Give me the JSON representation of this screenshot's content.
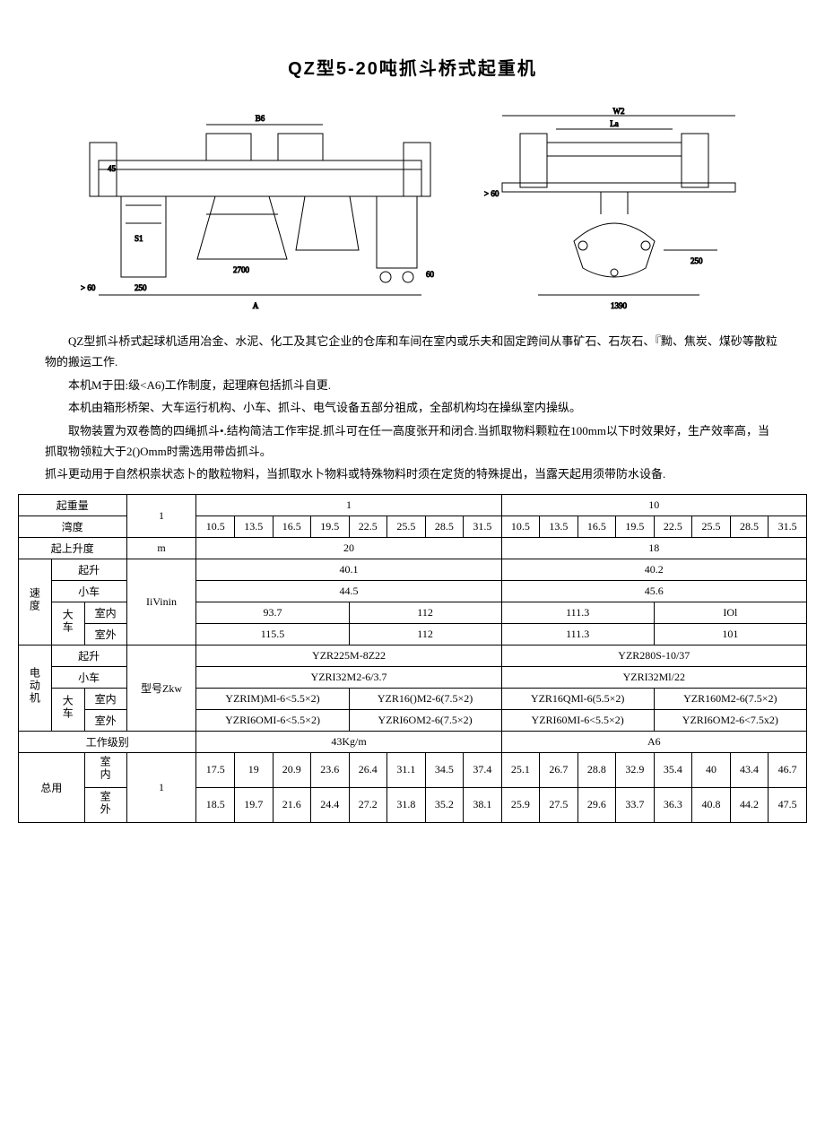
{
  "title": "QZ型5-20吨抓斗桥式起重机",
  "desc": {
    "p1": "QZ型抓斗桥式起球机适用冶金、水泥、化工及其它企业的仓库和车间在室内或乐夫和固定跨间从事矿石、石灰石、『黝、焦炭、煤砂等散粒物的搬运工作.",
    "p2": "本机M于田:级<A6)工作制度，起理麻包括抓斗自更.",
    "p3": "本机由箱形桥架、大车运行机构、小车、抓斗、电气设备五部分祖成，全部机构均在操纵室内操纵。",
    "p4": "取物装置为双卷筒的四绳抓斗•.结构简洁工作牢捉.抓斗可在任一高度张开和闭合.当抓取物料颗粒在100mm以下时效果好，生产效率高，当抓取物领粒大于2()Omm时需选用带齿抓斗。",
    "p5": "抓斗更动用于自然枳祟状态卜的散粒物料，当抓取水卜物料或特殊物料时须在定货的特殊提出，当露天起用须带防水设备."
  },
  "headers": {
    "lifting_weight": "起重量",
    "span": "湾度",
    "lift_height": "起上升度",
    "speed": "速度",
    "hoist": "起升",
    "trolley": "小车",
    "bridge": "大车",
    "indoor": "室内",
    "outdoor": "室外",
    "motor": "电动机",
    "model_power": "型号Zkw",
    "work_class": "工作级别",
    "total_weight": "总用",
    "unit_m": "m",
    "unit_speed": "IiVinin",
    "unit_t": "1"
  },
  "spec": {
    "weight_1": "1",
    "weight_10": "10",
    "spans_1": [
      "10.5",
      "13.5",
      "16.5",
      "19.5",
      "22.5",
      "25.5",
      "28.5",
      "31.5"
    ],
    "spans_10": [
      "10.5",
      "13.5",
      "16.5",
      "19.5",
      "22.5",
      "25.5",
      "28.5",
      "31.5"
    ],
    "lift_h_1": "20",
    "lift_h_10": "18",
    "hoist_spd_1": "40.1",
    "hoist_spd_10": "40.2",
    "trolley_spd_1": "44.5",
    "trolley_spd_10": "45.6",
    "bridge_in_1a": "93.7",
    "bridge_in_1b": "112",
    "bridge_in_10a": "111.3",
    "bridge_in_10b": "IOl",
    "bridge_out_1a": "115.5",
    "bridge_out_1b": "112",
    "bridge_out_10a": "111.3",
    "bridge_out_10b": "101",
    "motor_hoist_1": "YZR225M-8Z22",
    "motor_hoist_10": "YZR280S-10/37",
    "motor_trolley_1": "YZRI32M2-6/3.7",
    "motor_trolley_10": "YZRI32Ml/22",
    "motor_bridge_in_1a": "YZRIM)Ml-6<5.5×2)",
    "motor_bridge_in_1b": "YZR16()M2-6(7.5×2)",
    "motor_bridge_in_10a": "YZR16QMl-6(5.5×2)",
    "motor_bridge_in_10b": "YZR160M2-6(7.5×2)",
    "motor_bridge_out_1a": "YZRI6OMI-6<5.5×2)",
    "motor_bridge_out_1b": "YZRI6OM2-6(7.5×2)",
    "motor_bridge_out_10a": "YZRI60MI-6<5.5×2)",
    "motor_bridge_out_10b": "YZRI6OM2-6<7.5x2)",
    "work_class_1": "43Kg/m",
    "work_class_10": "A6",
    "tw_in_1": [
      "17.5",
      "19",
      "20.9",
      "23.6",
      "26.4",
      "31.1",
      "34.5",
      "37.4"
    ],
    "tw_in_10": [
      "25.1",
      "26.7",
      "28.8",
      "32.9",
      "35.4",
      "40",
      "43.4",
      "46.7"
    ],
    "tw_out_1": [
      "18.5",
      "19.7",
      "21.6",
      "24.4",
      "27.2",
      "31.8",
      "35.2",
      "38.1"
    ],
    "tw_out_10": [
      "25.9",
      "27.5",
      "29.6",
      "33.7",
      "36.3",
      "40.8",
      "44.2",
      "47.5"
    ]
  },
  "diagram_labels": {
    "d1": [
      "B6",
      "45",
      "S1",
      "250",
      "2700",
      "> 60",
      "60",
      "A"
    ],
    "d2": [
      "W2",
      "La",
      "> 60",
      "250",
      "1390"
    ]
  }
}
